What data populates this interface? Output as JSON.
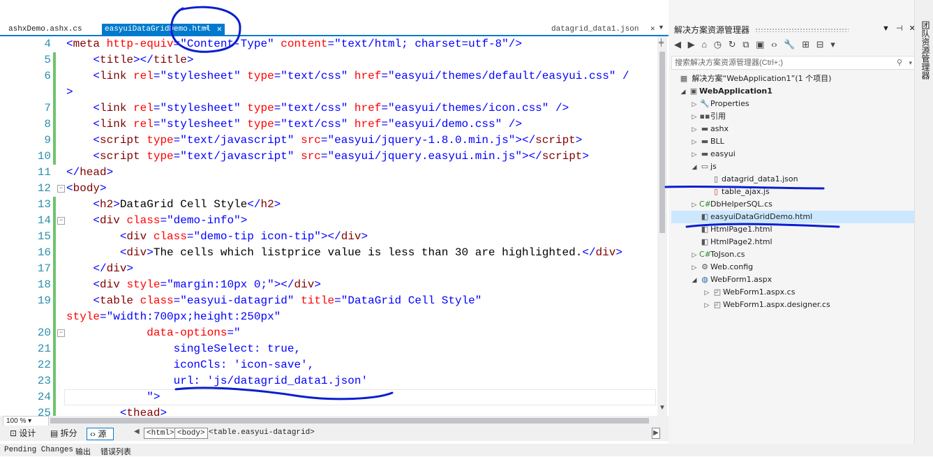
{
  "editor": {
    "tabs": [
      {
        "label": "ashxDemo.ashx.cs"
      },
      {
        "label": "easyuiDataGridDemo.html"
      },
      {
        "label": "datagrid_data1.json"
      }
    ],
    "zoom": "100 %",
    "lines": [
      {
        "num": "4"
      },
      {
        "num": "5"
      },
      {
        "num": "6"
      },
      {
        "num": ""
      },
      {
        "num": "7"
      },
      {
        "num": "8"
      },
      {
        "num": "9"
      },
      {
        "num": "10"
      },
      {
        "num": "11"
      },
      {
        "num": "12"
      },
      {
        "num": "13"
      },
      {
        "num": "14"
      },
      {
        "num": "15"
      },
      {
        "num": "16"
      },
      {
        "num": "17"
      },
      {
        "num": "18"
      },
      {
        "num": "19"
      },
      {
        "num": ""
      },
      {
        "num": "20"
      },
      {
        "num": "21"
      },
      {
        "num": "22"
      },
      {
        "num": "23"
      },
      {
        "num": "24"
      },
      {
        "num": "25"
      }
    ],
    "code": {
      "l4": {
        "tag": "meta",
        "a1": "http-equiv",
        "v1": "\"Content-Type\"",
        "a2": "content",
        "v2": "\"text/html; charset=utf-8\""
      },
      "l5": {
        "tag": "title",
        "close": "title"
      },
      "l6": {
        "tag": "link",
        "a1": "rel",
        "v1": "\"stylesheet\"",
        "a2": "type",
        "v2": "\"text/css\"",
        "a3": "href",
        "v3": "\"easyui/themes/default/easyui.css\"",
        "tail": " /"
      },
      "l6b": {
        "end": ">"
      },
      "l7": {
        "tag": "link",
        "a1": "rel",
        "v1": "\"stylesheet\"",
        "a2": "type",
        "v2": "\"text/css\"",
        "a3": "href",
        "v3": "\"easyui/themes/icon.css\""
      },
      "l8": {
        "tag": "link",
        "a1": "rel",
        "v1": "\"stylesheet\"",
        "a2": "type",
        "v2": "\"text/css\"",
        "a3": "href",
        "v3": "\"easyui/demo.css\""
      },
      "l9": {
        "tag": "script",
        "a1": "type",
        "v1": "\"text/javascript\"",
        "a2": "src",
        "v2": "\"easyui/jquery-1.8.0.min.js\"",
        "close": "script"
      },
      "l10": {
        "tag": "script",
        "a1": "type",
        "v1": "\"text/javascript\"",
        "a2": "src",
        "v2": "\"easyui/jquery.easyui.min.js\"",
        "close": "script"
      },
      "l11": {
        "close": "head"
      },
      "l12": {
        "tag": "body"
      },
      "l13": {
        "tag": "h2",
        "text": "DataGrid Cell Style",
        "close": "h2"
      },
      "l14": {
        "tag": "div",
        "a1": "class",
        "v1": "\"demo-info\""
      },
      "l15": {
        "tag": "div",
        "a1": "class",
        "v1": "\"demo-tip icon-tip\"",
        "close": "div"
      },
      "l16": {
        "tag": "div",
        "text": "The cells which listprice value is less than 30 are highlighted.",
        "close": "div"
      },
      "l17": {
        "close": "div"
      },
      "l18": {
        "tag": "div",
        "a1": "style",
        "v1": "\"margin:10px 0;\"",
        "close": "div"
      },
      "l19": {
        "tag": "table",
        "a1": "class",
        "v1": "\"easyui-datagrid\"",
        "a2": "title",
        "v2": "\"DataGrid Cell Style\""
      },
      "l19b": {
        "a1": "style",
        "v1": "\"width:700px;height:250px\""
      },
      "l20": {
        "a1": "data-options",
        "v1": "\""
      },
      "l21": {
        "text": "singleSelect: true,"
      },
      "l22": {
        "text": "iconCls: 'icon-save',"
      },
      "l23": {
        "text": "url: 'js/datagrid_data1.json'"
      },
      "l24": {
        "text": "\">"
      },
      "l25": {
        "tag": "thead"
      }
    }
  },
  "view_switch": {
    "design": "设计",
    "split": "拆分",
    "source": "源"
  },
  "breadcrumb": [
    "<html>",
    "<body>",
    "<table.easyui-datagrid>"
  ],
  "bottom_tabs": [
    "Pending Changes",
    "输出",
    "错误列表"
  ],
  "solution_explorer": {
    "title": "解决方案资源管理器",
    "search_placeholder": "搜索解决方案资源管理器(Ctrl+;)",
    "side_label": "团队资源管理器",
    "tree": [
      {
        "label": "解决方案“WebApplication1”(1 个项目)",
        "icon": "solution-icon"
      },
      {
        "label": "WebApplication1",
        "icon": "project-icon"
      },
      {
        "label": "Properties",
        "icon": "wrench-icon"
      },
      {
        "label": "引用",
        "icon": "references-icon"
      },
      {
        "label": "ashx",
        "icon": "folder-icon"
      },
      {
        "label": "BLL",
        "icon": "folder-icon"
      },
      {
        "label": "easyui",
        "icon": "folder-icon"
      },
      {
        "label": "js",
        "icon": "folder-open-icon"
      },
      {
        "label": "datagrid_data1.json",
        "icon": "file-icon"
      },
      {
        "label": "table_ajax.js",
        "icon": "js-file-icon"
      },
      {
        "label": "DbHelperSQL.cs",
        "icon": "csharp-icon"
      },
      {
        "label": "easyuiDataGridDemo.html",
        "icon": "html-file-icon"
      },
      {
        "label": "HtmlPage1.html",
        "icon": "html-file-icon"
      },
      {
        "label": "HtmlPage2.html",
        "icon": "html-file-icon"
      },
      {
        "label": "ToJson.cs",
        "icon": "csharp-icon"
      },
      {
        "label": "Web.config",
        "icon": "config-icon"
      },
      {
        "label": "WebForm1.aspx",
        "icon": "web-form-icon"
      },
      {
        "label": "WebForm1.aspx.cs",
        "icon": "code-file-icon"
      },
      {
        "label": "WebForm1.aspx.designer.cs",
        "icon": "code-file-icon"
      }
    ]
  },
  "colors": {
    "accent": "#007acc",
    "tag": "#800000",
    "attribute": "#ff0000",
    "value": "#0000ff",
    "line_number": "#2b91af",
    "annotation": "#0a1ecf"
  }
}
